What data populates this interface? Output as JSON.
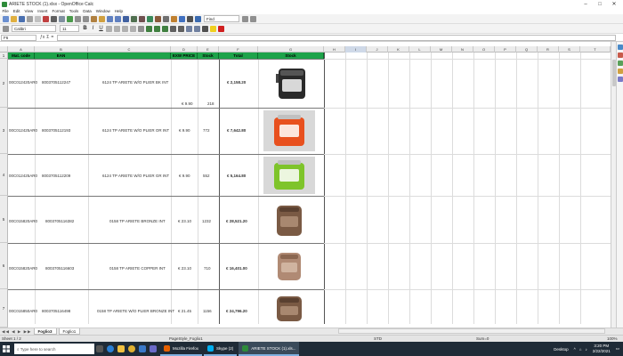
{
  "window": {
    "title": "ARIETE STOCK (1).xlsx - OpenOffice Calc"
  },
  "menu": [
    "File",
    "Edit",
    "View",
    "Insert",
    "Format",
    "Tools",
    "Data",
    "Window",
    "Help"
  ],
  "toolbar": {
    "font_name": "Calibri",
    "font_size": "11",
    "find_placeholder": "Find"
  },
  "formula_bar": {
    "cell_ref": "F6"
  },
  "columns": [
    "A",
    "B",
    "C",
    "D",
    "E",
    "F",
    "G",
    "H",
    "I",
    "J",
    "K",
    "L",
    "M",
    "N",
    "O",
    "P",
    "Q",
    "R",
    "S",
    "T"
  ],
  "row_numbers": [
    "1",
    "2",
    "3",
    "4",
    "5",
    "6",
    "7"
  ],
  "table": {
    "headers": [
      "Mat. code",
      "EAN",
      "",
      "EXW PRICE",
      "Stock",
      "Total",
      "Stock"
    ],
    "rows": [
      {
        "code": "00C012420AR0",
        "ean": "8003705112247",
        "desc": "6124 TP ARIETE W/O PLIER BK INT",
        "price": "€ 9.90",
        "stock": "218",
        "total": "€ 2,158.20",
        "image": "toaster-black"
      },
      {
        "code": "00C012425AR0",
        "ean": "8003705112193",
        "desc": "6124 TP ARIETE W/O PLIER OR INT",
        "price": "€ 9.90",
        "stock": "772",
        "total": "€ 7,642.80",
        "image": "toaster-orange"
      },
      {
        "code": "00C012425AR0",
        "ean": "8003705112209",
        "desc": "6124 TP ARIETE W/O PLIER GR INT",
        "price": "€ 9.90",
        "stock": "552",
        "total": "€ 5,164.80",
        "image": "toaster-green"
      },
      {
        "code": "00C015820AR0",
        "ean": "8003705116382",
        "desc": "0158 TP ARIETE BRONZE INT",
        "price": "€ 23.10",
        "stock": "1232",
        "total": "€ 28,521.20",
        "image": "toaster-bronze"
      },
      {
        "code": "00C015820AR0",
        "ean": "8003705116603",
        "desc": "0158 TP ARIETE COPPER INT",
        "price": "€ 23.10",
        "stock": "710",
        "total": "€ 16,401.00",
        "image": "toaster-copper"
      },
      {
        "code": "00C015850AR0",
        "ean": "8003705116498",
        "desc": "0158 TP ARIETE W/O PLIER BRONZE INT",
        "price": "€ 21.45",
        "stock": "1156",
        "total": "€ 24,796.20",
        "image": "toaster-bronze-2"
      }
    ]
  },
  "sheets": {
    "nav": "◀◀ ◀ ▶ ▶▶",
    "tabs": [
      "Foglio3",
      "Foglio1"
    ],
    "active": "Foglio3"
  },
  "status": {
    "sheet": "Sheet 1 / 2",
    "style": "PageStyle_Foglio1",
    "mode": "STD",
    "sum": "Sum=0",
    "zoom": "100%"
  },
  "taskbar": {
    "search_placeholder": "Type here to search",
    "windows": [
      {
        "label": "Mozilla Firefox",
        "color": "#e66000"
      },
      {
        "label": "Skype (2)",
        "color": "#00aff0"
      },
      {
        "label": "ARIETE STOCK (1).xls...",
        "color": "#2e8b3a"
      }
    ],
    "desktop_label": "Desktop",
    "time": "3:20 PM",
    "date": "2/22/2021"
  },
  "colors": {
    "header_green": "#1ea34a"
  }
}
